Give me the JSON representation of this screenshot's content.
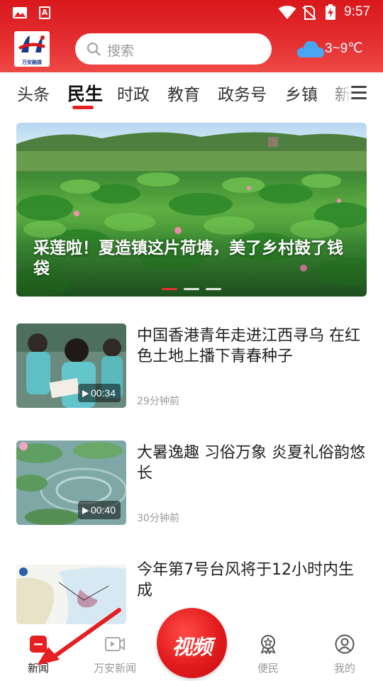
{
  "status_bar": {
    "time": "9:57",
    "left_icons": [
      "gallery-icon",
      "app-a-icon"
    ],
    "right_icons": [
      "wifi-icon",
      "no-sim-icon",
      "battery-charging-icon"
    ]
  },
  "header": {
    "logo_text": "万安融媒",
    "search_placeholder": "搜索",
    "weather_icon": "cloud-icon",
    "weather_temp": "3~9℃",
    "colors": {
      "header_red": "#e02325",
      "accent_red": "#e51f22",
      "weather_cloud": "#4aa5f2"
    }
  },
  "tabs": {
    "items": [
      "头条",
      "民生",
      "时政",
      "教育",
      "政务号",
      "乡镇",
      "新"
    ],
    "active_index": 1,
    "menu_icon": "hamburger-menu-icon"
  },
  "banner": {
    "title": "采莲啦！夏造镇这片荷塘，美了乡村鼓了钱袋",
    "slide_count": 3,
    "active_slide": 0
  },
  "news": [
    {
      "title": "中国香港青年走进江西寻乌 在红色土地上播下青春种子",
      "time": "29分钟前",
      "duration": "00:34",
      "thumbnail": "students-writing-outdoors"
    },
    {
      "title": "大暑逸趣 习俗万象 炎夏礼俗韵悠长",
      "time": "30分钟前",
      "duration": "00:40",
      "thumbnail": "lotus-pond-ripple"
    },
    {
      "title": "今年第7号台风将于12小时内生成",
      "time": "",
      "duration": "",
      "thumbnail": "typhoon-track-map"
    }
  ],
  "bottom_nav": {
    "items": [
      {
        "label": "新闻",
        "icon": "news-icon",
        "active": true
      },
      {
        "label": "万安新闻",
        "icon": "video-play-icon",
        "active": false
      },
      {
        "label": "视频",
        "icon": "video-center-button",
        "active": false
      },
      {
        "label": "便民",
        "icon": "service-badge-icon",
        "active": false
      },
      {
        "label": "我的",
        "icon": "user-profile-icon",
        "active": false
      }
    ]
  }
}
